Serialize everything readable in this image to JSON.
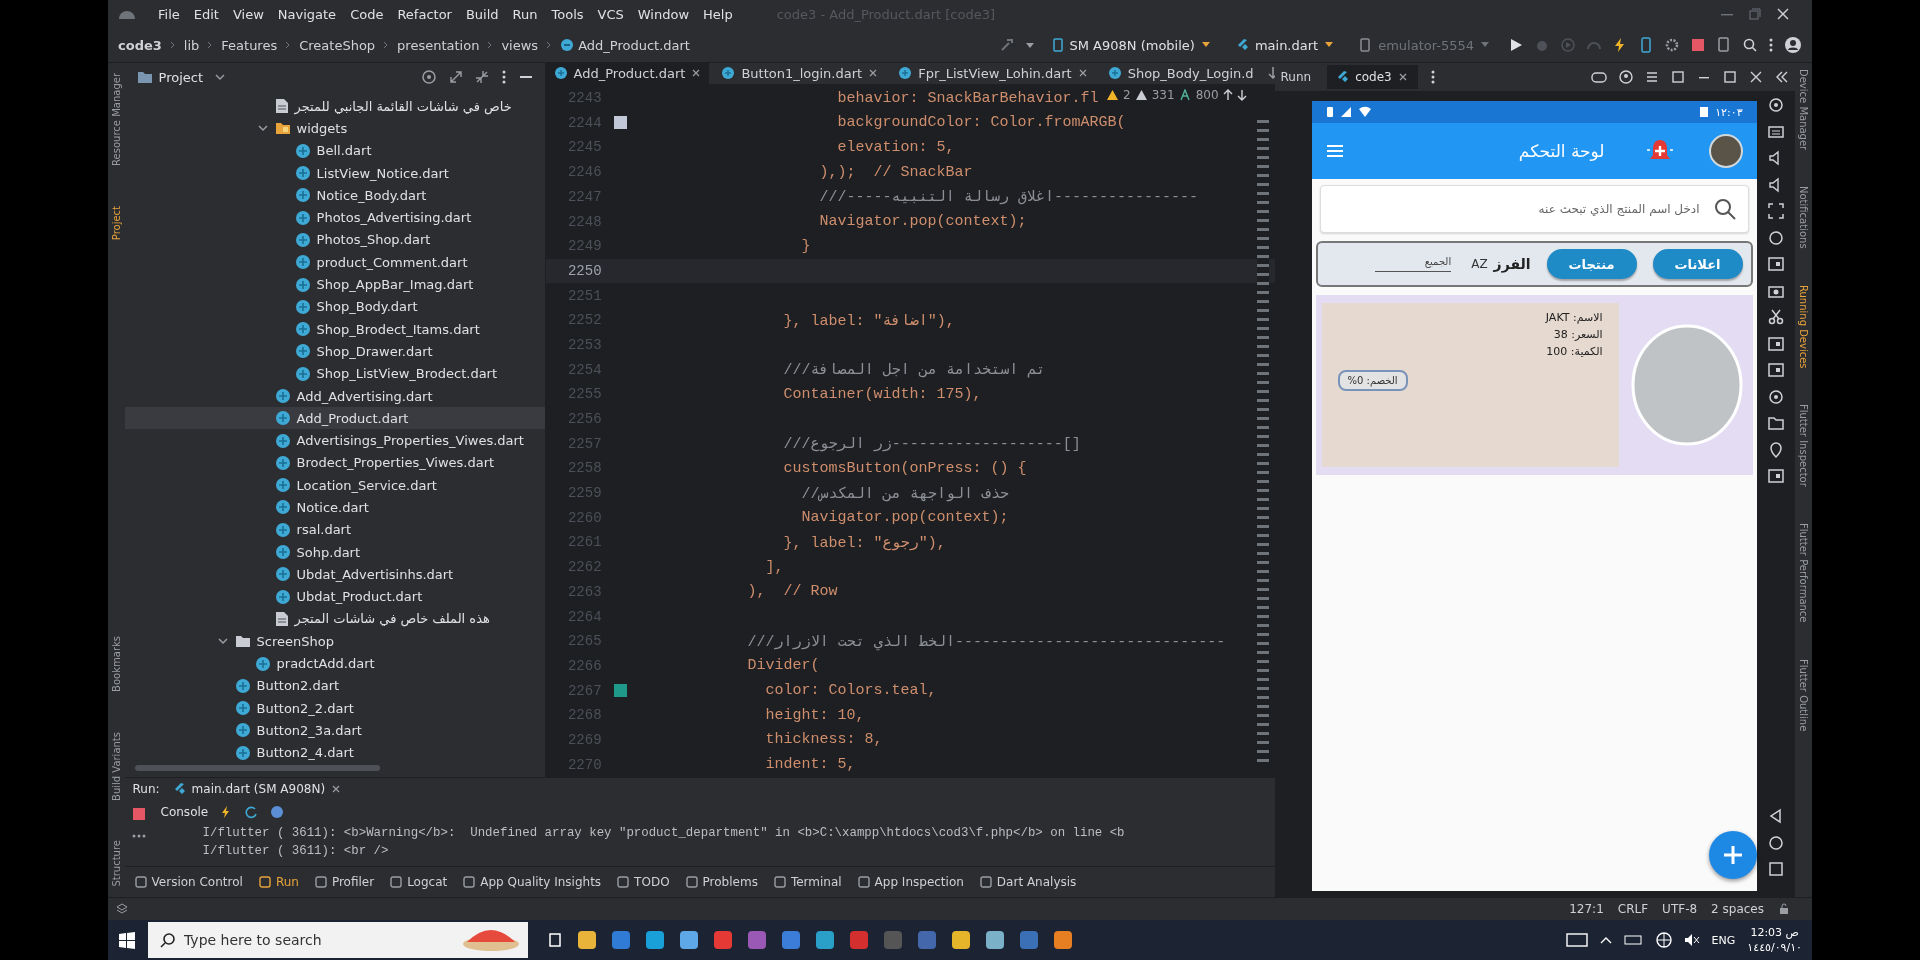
{
  "menu_bar": {
    "items": [
      "File",
      "Edit",
      "View",
      "Navigate",
      "Code",
      "Refactor",
      "Build",
      "Run",
      "Tools",
      "VCS",
      "Window",
      "Help"
    ],
    "title": "code3 - Add_Product.dart [code3]"
  },
  "breadcrumb": [
    "code3",
    "lib",
    "Features",
    "CreateShop",
    "presentation",
    "views",
    "Add_Product.dart"
  ],
  "toolbar": {
    "device": "SM A908N (mobile)",
    "config": "main.dart",
    "emulator": {
      "label": "emulator-5554",
      "disabled": true
    }
  },
  "left_strip": [
    {
      "label": "Resource Manager",
      "selected": false
    },
    {
      "label": "Project",
      "selected": true
    },
    {
      "label": "Bookmarks",
      "selected": false
    },
    {
      "label": "Build Variants",
      "selected": false
    },
    {
      "label": "Structure",
      "selected": false
    }
  ],
  "project": {
    "title": "Project",
    "tree": [
      {
        "children": [
          {
            "name": "خاص في شاشات القائمة الجانبي للمتجر",
            "kind": "text",
            "selected": false
          },
          {
            "name": "widgets",
            "kind": "package",
            "expanded": true,
            "selected": false,
            "children": [
              {
                "name": "Bell.dart",
                "kind": "dart",
                "selected": false
              },
              {
                "name": "ListView_Notice.dart",
                "kind": "dart",
                "selected": false
              },
              {
                "name": "Notice_Body.dart",
                "kind": "dart",
                "selected": false
              },
              {
                "name": "Photos_Advertising.dart",
                "kind": "dart",
                "selected": false
              },
              {
                "name": "Photos_Shop.dart",
                "kind": "dart",
                "selected": false
              },
              {
                "name": "product_Comment.dart",
                "kind": "dart",
                "selected": false
              },
              {
                "name": "Shop_AppBar_Imag.dart",
                "kind": "dart",
                "selected": false
              },
              {
                "name": "Shop_Body.dart",
                "kind": "dart",
                "selected": false
              },
              {
                "name": "Shop_Brodect_Itams.dart",
                "kind": "dart",
                "selected": false
              },
              {
                "name": "Shop_Drawer.dart",
                "kind": "dart",
                "selected": false
              },
              {
                "name": "Shop_ListView_Brodect.dart",
                "kind": "dart",
                "selected": false
              }
            ]
          },
          {
            "name": "Add_Advertising.dart",
            "kind": "dart",
            "selected": false
          },
          {
            "name": "Add_Product.dart",
            "kind": "dart",
            "selected": true
          },
          {
            "name": "Advertisings_Properties_Viwes.dart",
            "kind": "dart",
            "selected": false
          },
          {
            "name": "Brodect_Properties_Viwes.dart",
            "kind": "dart",
            "selected": false
          },
          {
            "name": "Location_Service.dart",
            "kind": "dart",
            "selected": false
          },
          {
            "name": "Notice.dart",
            "kind": "dart",
            "selected": false
          },
          {
            "name": "rsal.dart",
            "kind": "dart",
            "selected": false
          },
          {
            "name": "Sohp.dart",
            "kind": "dart",
            "selected": false
          },
          {
            "name": "Ubdat_Advertisinhs.dart",
            "kind": "dart",
            "selected": false
          },
          {
            "name": "Ubdat_Product.dart",
            "kind": "dart",
            "selected": false
          },
          {
            "name": "هذه الملف خاص في شاشات المتجر",
            "kind": "text",
            "selected": false
          }
        ]
      },
      {
        "name": "ScreenShop",
        "kind": "folder",
        "expanded": true,
        "selected": false,
        "children": [
          {
            "name": "pradctAdd.dart",
            "kind": "dart",
            "selected": false
          }
        ]
      },
      {
        "name": "Button2.dart",
        "kind": "dart",
        "selected": false
      },
      {
        "name": "Button2_2.dart",
        "kind": "dart",
        "selected": false
      },
      {
        "name": "Button2_3a.dart",
        "kind": "dart",
        "selected": false
      },
      {
        "name": "Button2_4.dart",
        "kind": "dart",
        "selected": false
      }
    ]
  },
  "editor": {
    "tabs": [
      {
        "label": "Add_Product.dart",
        "selected": true
      },
      {
        "label": "Button1_login.dart",
        "selected": false
      },
      {
        "label": "Fpr_ListView_Lohin.dart",
        "selected": false
      },
      {
        "label": "Shop_Body_Login.d",
        "selected": false
      }
    ],
    "inspection": {
      "errors": "2",
      "warnings": "331",
      "typos": "800"
    },
    "lines": [
      {
        "n": "2243",
        "text": "                      behavior: SnackBarBehavior.fl",
        "kind": "code",
        "current": false
      },
      {
        "n": "2244",
        "text": "                      backgroundColor: Color.fromARGB(",
        "kind": "code",
        "current": false,
        "color": "#c3c8d8"
      },
      {
        "n": "2245",
        "text": "                      elevation: 5,",
        "kind": "code",
        "current": false
      },
      {
        "n": "2246",
        "text": "                    ),);  // SnackBar",
        "kind": "code",
        "current": false
      },
      {
        "n": "2247",
        "text": "                    ///-----اغلاق رسالة التنبيه----------------",
        "kind": "comment",
        "current": false
      },
      {
        "n": "2248",
        "text": "                    Navigator.pop(context);",
        "kind": "code",
        "current": false
      },
      {
        "n": "2249",
        "text": "                  }",
        "kind": "code",
        "current": false
      },
      {
        "n": "2250",
        "current": true
      },
      {
        "n": "2251",
        "current": false
      },
      {
        "n": "2252",
        "text": "                }, label: \"اضافة\"),",
        "kind": "code",
        "current": false
      },
      {
        "n": "2253",
        "current": false
      },
      {
        "n": "2254",
        "text": "                ///تم استخدامة من اجل المصافة",
        "kind": "comment",
        "current": false
      },
      {
        "n": "2255",
        "text": "                Container(width: 175),",
        "kind": "code",
        "current": false
      },
      {
        "n": "2256",
        "current": false
      },
      {
        "n": "2257",
        "text": "                ///زر الرجوع-------------------[]",
        "kind": "comment",
        "current": false
      },
      {
        "n": "2258",
        "text": "                customsButton(onPress: () {",
        "kind": "code",
        "current": false
      },
      {
        "n": "2259",
        "text": "                  //حذف الواجهة من المكدس",
        "kind": "comment",
        "current": false
      },
      {
        "n": "2260",
        "text": "                  Navigator.pop(context);",
        "kind": "code",
        "current": false
      },
      {
        "n": "2261",
        "text": "                }, label: \"رجوع\"),",
        "kind": "code",
        "current": false
      },
      {
        "n": "2262",
        "text": "              ],",
        "kind": "code",
        "current": false
      },
      {
        "n": "2263",
        "text": "            ),  // Row",
        "kind": "code",
        "current": false
      },
      {
        "n": "2264",
        "current": false
      },
      {
        "n": "2265",
        "text": "            ///الخط الذي تحت الازرار------------------------------",
        "kind": "comment",
        "current": false
      },
      {
        "n": "2266",
        "text": "            Divider(",
        "kind": "code",
        "current": false
      },
      {
        "n": "2267",
        "text": "              color: Colors.teal,",
        "kind": "code",
        "current": false,
        "color": "#1f9a8a"
      },
      {
        "n": "2268",
        "text": "              height: 10,",
        "kind": "code",
        "current": false
      },
      {
        "n": "2269",
        "text": "              thickness: 8,",
        "kind": "code",
        "current": false
      },
      {
        "n": "2270",
        "text": "              indent: 5,",
        "kind": "code",
        "current": false
      }
    ]
  },
  "running_devices": {
    "label": "Runn",
    "tab": "code3"
  },
  "emulator": {
    "status_time": "١٢:٠٣",
    "app_title": "لوحة التحكم",
    "search_placeholder": "ادخل اسم المنتج الذي تبحث عنه",
    "filter_buttons": [
      "اعلانات",
      "منتجات"
    ],
    "sort_label": "الفرز",
    "sort_glyph": "AZ",
    "dropdown": "الجميع",
    "products": [
      {
        "lines": [
          "الاسم:  JAKT",
          "السعر: 38",
          "الكمية: 100"
        ],
        "discount": "الخصم: 0%"
      }
    ]
  },
  "right_strip": [
    {
      "label": "Device Manager",
      "selected": false
    },
    {
      "label": "Notifications",
      "selected": false
    },
    {
      "label": "Running Devices",
      "selected": true
    },
    {
      "label": "Flutter Inspector",
      "selected": false
    },
    {
      "label": "Flutter Performance",
      "selected": false
    },
    {
      "label": "Flutter Outline",
      "selected": false
    }
  ],
  "run_panel": {
    "title": "Run:",
    "tab": "main.dart (SM A908N)",
    "console": "Console",
    "lines": [
      "I/flutter ( 3611): <b>Warning</b>:  Undefined array key \"product_department\" in <b>C:\\xampp\\htdocs\\cod3\\f.php</b> on line <b",
      "I/flutter ( 3611): <br />"
    ]
  },
  "tool_windows": [
    {
      "label": "Version Control",
      "selected": false
    },
    {
      "label": "Run",
      "selected": true
    },
    {
      "label": "Profiler",
      "selected": false
    },
    {
      "label": "Logcat",
      "selected": false
    },
    {
      "label": "App Quality Insights",
      "selected": false
    },
    {
      "label": "TODO",
      "selected": false
    },
    {
      "label": "Problems",
      "selected": false
    },
    {
      "label": "Terminal",
      "selected": false
    },
    {
      "label": "App Inspection",
      "selected": false
    },
    {
      "label": "Dart Analysis",
      "selected": false
    }
  ],
  "status_bar": [
    "127:1",
    "CRLF",
    "UTF-8",
    "2 spaces"
  ],
  "taskbar": {
    "search_placeholder": "Type here to search",
    "language": "ENG",
    "time": "12:03 ص",
    "date": "١٤٤٥/٠٩/١٠"
  }
}
